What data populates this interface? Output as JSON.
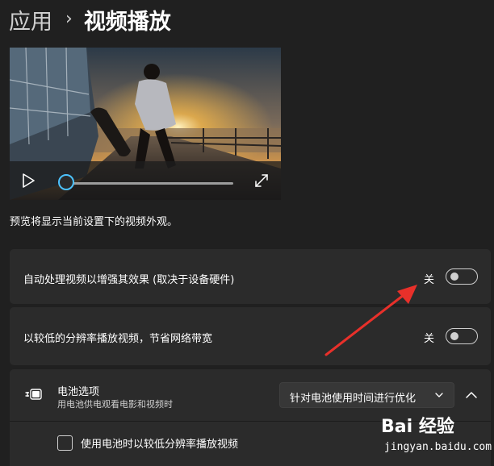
{
  "breadcrumb": {
    "parent": "应用",
    "separator": "›",
    "title": "视频播放"
  },
  "preview": {
    "caption": "预览将显示当前设置下的视频外观。",
    "playback_progress": 0
  },
  "settings": [
    {
      "id": "auto-process",
      "label": "自动处理视频以增强其效果 (取决于设备硬件)",
      "state_text": "关",
      "on": false
    },
    {
      "id": "low-resolution",
      "label": "以较低的分辨率播放视频，节省网络带宽",
      "state_text": "关",
      "on": false
    }
  ],
  "battery": {
    "title": "电池选项",
    "subtitle": "用电池供电观看电影和视频时",
    "dropdown_value": "针对电池使用时间进行优化",
    "checkbox_label": "使用电池时以较低分辨率播放视频",
    "checkbox_checked": false
  },
  "watermark": {
    "logo": "Bai 经验",
    "url": "jingyan.baidu.com"
  },
  "colors": {
    "accent": "#4cc2ff",
    "background": "#202020",
    "card": "#2b2b2b",
    "arrow": "#e8302a"
  },
  "icons": {
    "play": "play-icon",
    "fullscreen": "fullscreen-icon",
    "battery": "battery-saver-icon",
    "chevron_down": "chevron-down-icon",
    "chevron_up": "chevron-up-icon",
    "paw": "baidu-paw-icon"
  }
}
